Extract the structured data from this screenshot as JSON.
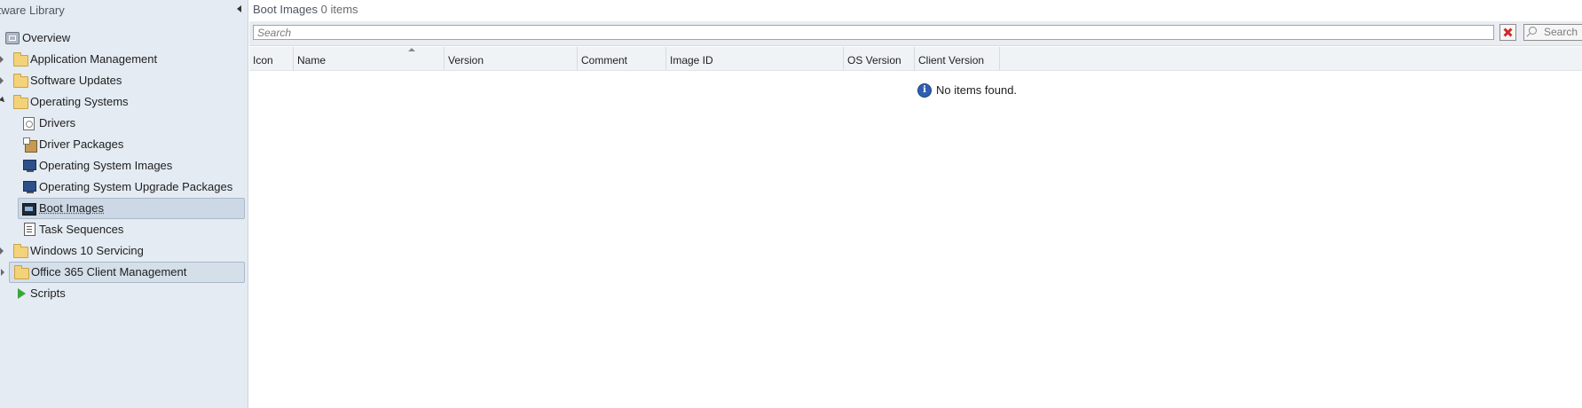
{
  "nav": {
    "header": "ftware Library",
    "items": [
      {
        "label": "Overview",
        "icon": "overview-icon"
      },
      {
        "label": "Application Management",
        "icon": "folder-icon"
      },
      {
        "label": "Software Updates",
        "icon": "folder-icon"
      },
      {
        "label": "Operating Systems",
        "icon": "folder-icon"
      },
      {
        "label": "Drivers",
        "icon": "driver-icon"
      },
      {
        "label": "Driver Packages",
        "icon": "package-icon"
      },
      {
        "label": "Operating System Images",
        "icon": "os-image-icon"
      },
      {
        "label": "Operating System Upgrade Packages",
        "icon": "upgrade-package-icon"
      },
      {
        "label": "Boot Images",
        "icon": "boot-image-icon"
      },
      {
        "label": "Task Sequences",
        "icon": "task-sequence-icon"
      },
      {
        "label": "Windows 10 Servicing",
        "icon": "folder-icon"
      },
      {
        "label": "Office 365 Client Management",
        "icon": "folder-icon"
      },
      {
        "label": "Scripts",
        "icon": "play-icon"
      }
    ],
    "selected": "Boot Images"
  },
  "main": {
    "title": "Boot Images",
    "count": "0 items",
    "search": {
      "placeholder": "Search",
      "button_label": "Search"
    },
    "columns": [
      "Icon",
      "Name",
      "Version",
      "Comment",
      "Image ID",
      "OS Version",
      "Client Version"
    ],
    "sort_column": "Name",
    "empty_message": "No items found."
  },
  "colors": {
    "nav_background": "#e4ebf3",
    "selection": "#ccd8e6",
    "clear_icon": "#d02a2a",
    "info_icon": "#2f5fb3"
  }
}
